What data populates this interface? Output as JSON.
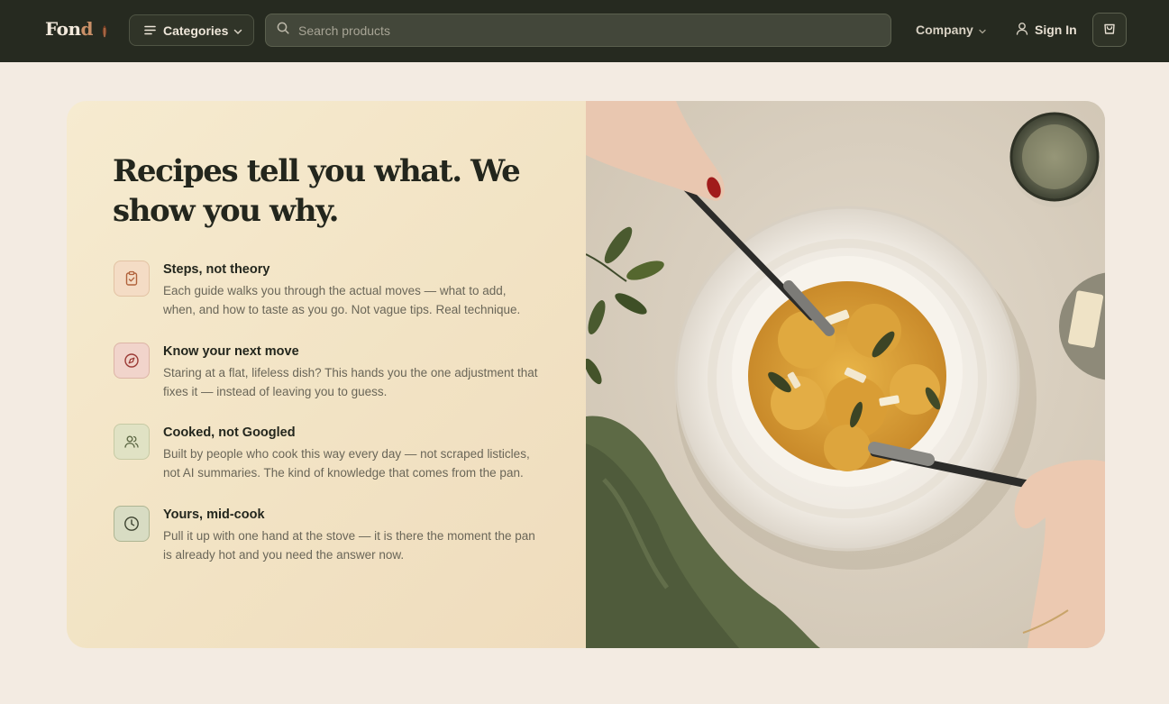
{
  "header": {
    "logo": {
      "main": "Fon",
      "accent": "d"
    },
    "categories_label": "Categories",
    "search_placeholder": "Search products",
    "company_label": "Company",
    "signin_label": "Sign In"
  },
  "hero": {
    "headline": "Recipes tell you what. We show you why.",
    "features": [
      {
        "title": "Steps, not theory",
        "description": "Each guide walks you through the actual moves — what to add, when, and how to taste as you go. Not vague tips. Real technique.",
        "icon": "clipboard-check-icon"
      },
      {
        "title": "Know your next move",
        "description": "Staring at a flat, lifeless dish? This hands you the one adjustment that fixes it — instead of leaving you to guess.",
        "icon": "compass-icon"
      },
      {
        "title": "Cooked, not Googled",
        "description": "Built by people who cook this way every day — not scraped listicles, not AI summaries. The kind of knowledge that comes from the pan.",
        "icon": "users-icon"
      },
      {
        "title": "Yours, mid-cook",
        "description": "Pull it up with one hand at the stove — it is there the moment the pan is already hot and you need the answer now.",
        "icon": "clock-icon"
      }
    ],
    "image": "ravioli-plate-photo"
  },
  "colors": {
    "header_bg": "#262a20",
    "page_bg": "#f3ebe2",
    "panel_bg": "#f4e7cb",
    "heading": "#23261d"
  }
}
